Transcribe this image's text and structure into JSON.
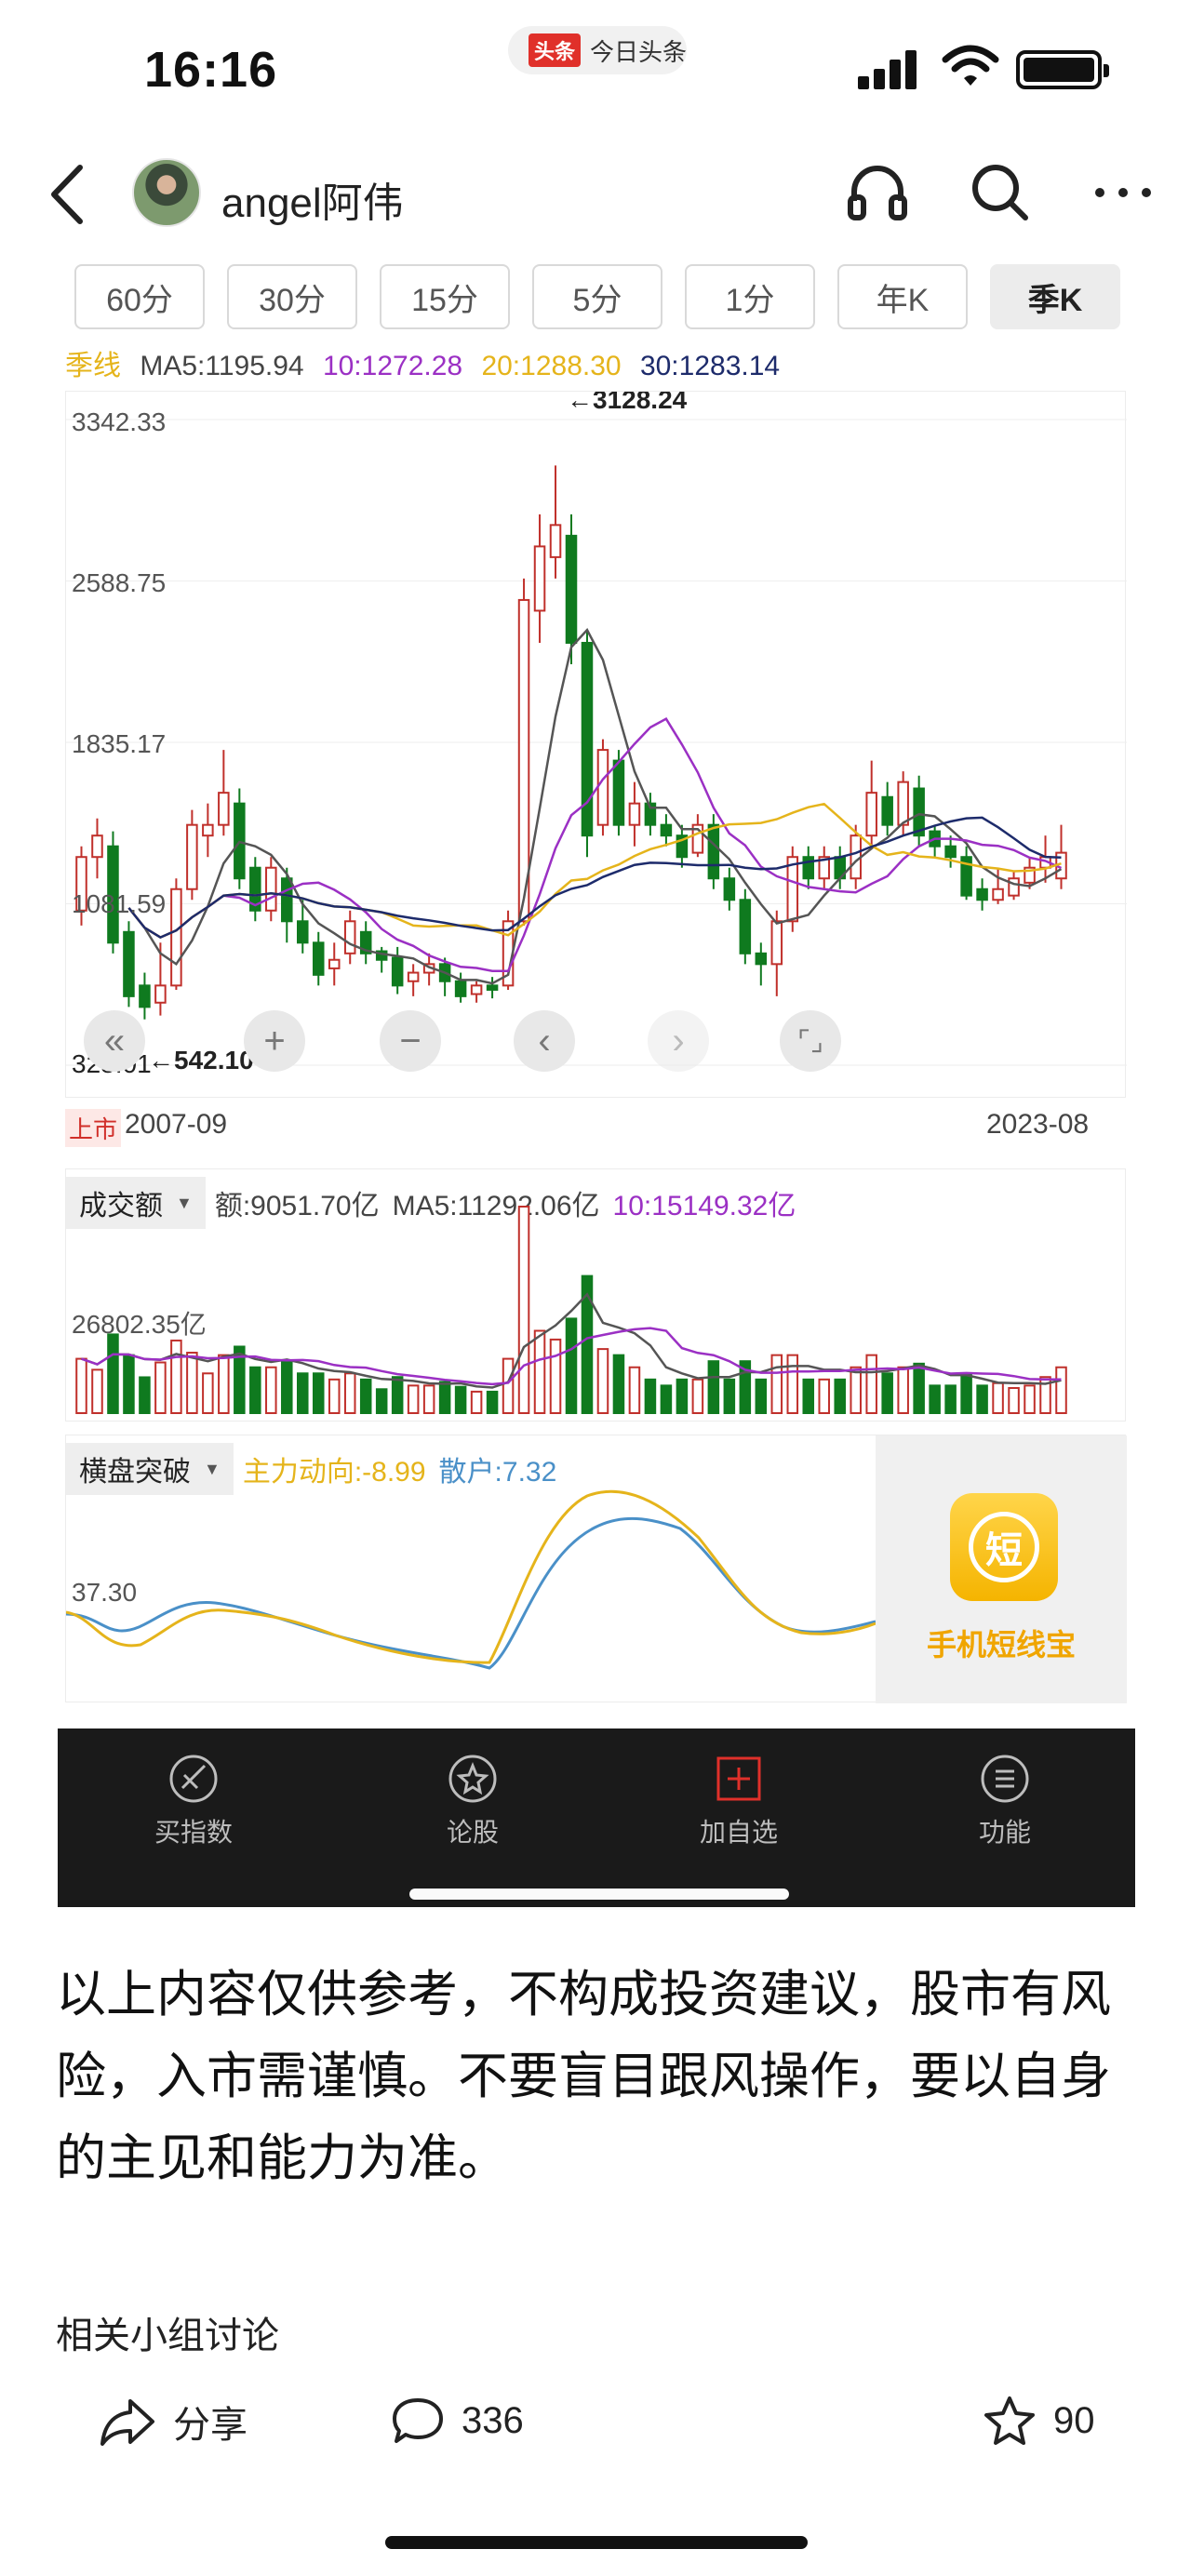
{
  "status_bar": {
    "time": "16:16",
    "app_badge": "头条",
    "app_name": "今日头条"
  },
  "header": {
    "author": "angel阿伟",
    "icons": [
      "back-arrow-icon",
      "headphones-icon",
      "search-icon",
      "more-dots-icon"
    ]
  },
  "periods": [
    {
      "label": "60分",
      "active": false
    },
    {
      "label": "30分",
      "active": false
    },
    {
      "label": "15分",
      "active": false
    },
    {
      "label": "5分",
      "active": false
    },
    {
      "label": "1分",
      "active": false
    },
    {
      "label": "年K",
      "active": false
    },
    {
      "label": "季K",
      "active": true
    }
  ],
  "ma": {
    "label": "季线",
    "ma5": "MA5:1195.94",
    "ma10": "10:1272.28",
    "ma20": "20:1288.30",
    "ma30": "30:1283.14"
  },
  "kline": {
    "y_ticks": [
      "3342.33",
      "2588.75",
      "1835.17",
      "1081.59",
      "328.01"
    ],
    "high_label": "←3128.24",
    "low_label": "←542.10",
    "ipo_badge": "上市",
    "start_date": "2007-09",
    "end_date": "2023-08"
  },
  "chart_controls": [
    "double-left-icon",
    "zoom-in-icon",
    "zoom-out-icon",
    "prev-icon",
    "next-icon",
    "fullscreen-icon"
  ],
  "volume": {
    "selector": "成交额",
    "amount": "额:9051.70亿",
    "ma5": "MA5:11292.06亿",
    "ma10": "10:15149.32亿",
    "tick": "26802.35亿"
  },
  "indicator": {
    "selector": "横盘突破",
    "main_force": "主力动向:-8.99",
    "retail": "散户:7.32",
    "tick": "37.30",
    "promo_logo": "短",
    "promo_text": "手机短线宝"
  },
  "tabbar": [
    {
      "label": "买指数",
      "icon": "buy-index-icon",
      "active": false
    },
    {
      "label": "论股",
      "icon": "discuss-icon",
      "active": false
    },
    {
      "label": "加自选",
      "icon": "add-watchlist-icon",
      "active": true
    },
    {
      "label": "功能",
      "icon": "menu-icon",
      "active": false
    }
  ],
  "article": {
    "text": "以上内容仅供参考，不构成投资建议，股市有风险，入市需谨慎。不要盲目跟风操作，要以自身的主见和能力为准。",
    "related": "相关小组讨论"
  },
  "actions": {
    "share_label": "分享",
    "comment_count": "336",
    "like_count": "90"
  },
  "colors": {
    "up": "#c0302b",
    "down": "#0f7a1f",
    "ma5": "#555555",
    "ma10": "#9b30c4",
    "ma20": "#e5b41b",
    "ma30": "#1d2b6b",
    "retail": "#4a90c8"
  },
  "chart_data": {
    "type": "candlestick",
    "period": "quarterly",
    "y_range": [
      328.01,
      3342.33
    ],
    "y_ticks": [
      3342.33,
      2588.75,
      1835.17,
      1081.59,
      328.01
    ],
    "x_range": [
      "2007-09",
      "2023-08"
    ],
    "high": 3128.24,
    "low": 542.1,
    "series": [
      {
        "name": "MA5",
        "value": 1195.94
      },
      {
        "name": "10",
        "value": 1272.28
      },
      {
        "name": "20",
        "value": 1288.3
      },
      {
        "name": "30",
        "value": 1283.14
      }
    ],
    "candles": [
      [
        1050,
        1300,
        980,
        1350
      ],
      [
        1300,
        1400,
        1200,
        1480
      ],
      [
        1350,
        900,
        850,
        1420
      ],
      [
        950,
        650,
        600,
        1000
      ],
      [
        700,
        600,
        542,
        760
      ],
      [
        620,
        700,
        560,
        900
      ],
      [
        700,
        1150,
        680,
        1200
      ],
      [
        1150,
        1450,
        1100,
        1520
      ],
      [
        1400,
        1450,
        1300,
        1550
      ],
      [
        1450,
        1600,
        1400,
        1800
      ],
      [
        1550,
        1200,
        1150,
        1620
      ],
      [
        1250,
        1050,
        1000,
        1300
      ],
      [
        1050,
        1250,
        1000,
        1300
      ],
      [
        1200,
        1000,
        900,
        1250
      ],
      [
        1000,
        900,
        850,
        1100
      ],
      [
        900,
        750,
        700,
        950
      ],
      [
        780,
        820,
        700,
        900
      ],
      [
        850,
        1000,
        800,
        1050
      ],
      [
        950,
        850,
        800,
        1000
      ],
      [
        860,
        820,
        760,
        880
      ],
      [
        830,
        700,
        660,
        880
      ],
      [
        720,
        760,
        650,
        800
      ],
      [
        760,
        800,
        700,
        850
      ],
      [
        800,
        720,
        650,
        830
      ],
      [
        720,
        650,
        620,
        760
      ],
      [
        660,
        700,
        620,
        720
      ],
      [
        700,
        680,
        640,
        740
      ],
      [
        700,
        1000,
        680,
        1050
      ],
      [
        1000,
        2500,
        980,
        2600
      ],
      [
        2450,
        2750,
        2300,
        2900
      ],
      [
        2700,
        2850,
        2600,
        3128
      ],
      [
        2800,
        2300,
        2200,
        2900
      ],
      [
        2300,
        1400,
        1300,
        2350
      ],
      [
        1450,
        1800,
        1400,
        1850
      ],
      [
        1750,
        1450,
        1400,
        1800
      ],
      [
        1450,
        1550,
        1350,
        1650
      ],
      [
        1550,
        1450,
        1400,
        1600
      ],
      [
        1450,
        1400,
        1350,
        1500
      ],
      [
        1400,
        1300,
        1250,
        1450
      ],
      [
        1320,
        1450,
        1300,
        1500
      ],
      [
        1450,
        1200,
        1150,
        1500
      ],
      [
        1200,
        1100,
        1050,
        1250
      ],
      [
        1100,
        850,
        800,
        1150
      ],
      [
        850,
        800,
        700,
        900
      ],
      [
        800,
        1000,
        650,
        1050
      ],
      [
        1000,
        1300,
        950,
        1350
      ],
      [
        1300,
        1200,
        1150,
        1350
      ],
      [
        1200,
        1300,
        1150,
        1350
      ],
      [
        1300,
        1200,
        1150,
        1350
      ],
      [
        1200,
        1400,
        1150,
        1450
      ],
      [
        1400,
        1600,
        1350,
        1750
      ],
      [
        1580,
        1450,
        1400,
        1650
      ],
      [
        1450,
        1650,
        1400,
        1700
      ],
      [
        1620,
        1400,
        1350,
        1680
      ],
      [
        1420,
        1350,
        1300,
        1450
      ],
      [
        1350,
        1300,
        1250,
        1400
      ],
      [
        1300,
        1120,
        1100,
        1350
      ],
      [
        1150,
        1100,
        1050,
        1200
      ],
      [
        1100,
        1150,
        1080,
        1250
      ],
      [
        1120,
        1200,
        1100,
        1230
      ],
      [
        1180,
        1250,
        1150,
        1300
      ],
      [
        1250,
        1300,
        1180,
        1400
      ],
      [
        1200,
        1320,
        1150,
        1450
      ]
    ]
  }
}
